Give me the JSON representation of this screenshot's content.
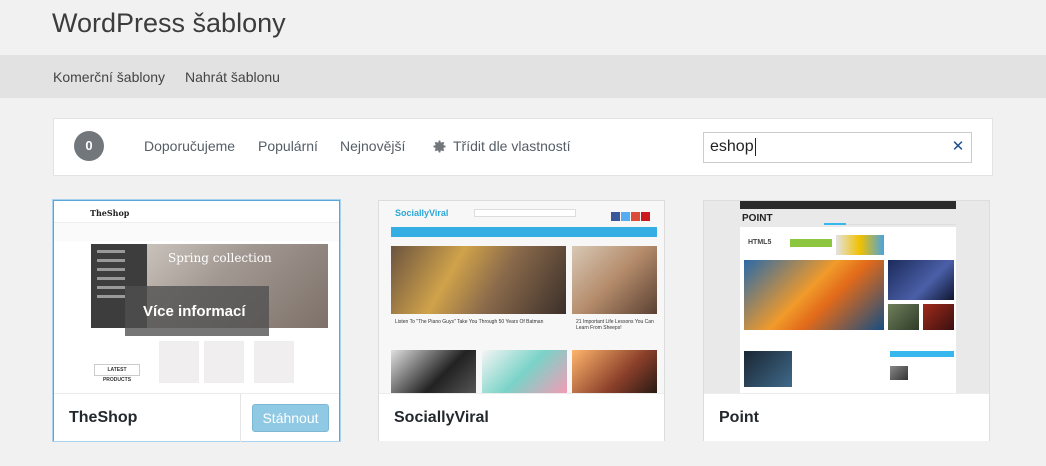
{
  "page_title": "WordPress šablony",
  "subnav": {
    "items": [
      "Komerční šablony",
      "Nahrát šablonu"
    ]
  },
  "filter_bar": {
    "count": "0",
    "links": [
      "Doporučujeme",
      "Populární",
      "Nejnovější"
    ],
    "feature_filter": "Třídit dle vlastností",
    "search_value": "eshop"
  },
  "themes": [
    {
      "name": "TheShop",
      "download_label": "Stáhnout",
      "overlay_label": "Více informací",
      "preview": {
        "logo": "TheShop",
        "hero_title": "Spring collection",
        "section_label": "LATEST PRODUCTS"
      }
    },
    {
      "name": "SociallyViral",
      "preview": {
        "logo": "SociallyViral",
        "caption_1": "Listen To \"The Piano Guys\" Take You Through 50 Years Of Batman",
        "caption_2": "21 Important Life Lessons You Can Learn From Sheeps!"
      }
    },
    {
      "name": "Point",
      "preview": {
        "logo": "POINT",
        "hero_label": "HTML5"
      }
    }
  ],
  "colors": {
    "accent": "#0073aa",
    "active_border": "#58a7d9",
    "download_button": "#8fc9e3",
    "count_badge": "#72777c"
  }
}
